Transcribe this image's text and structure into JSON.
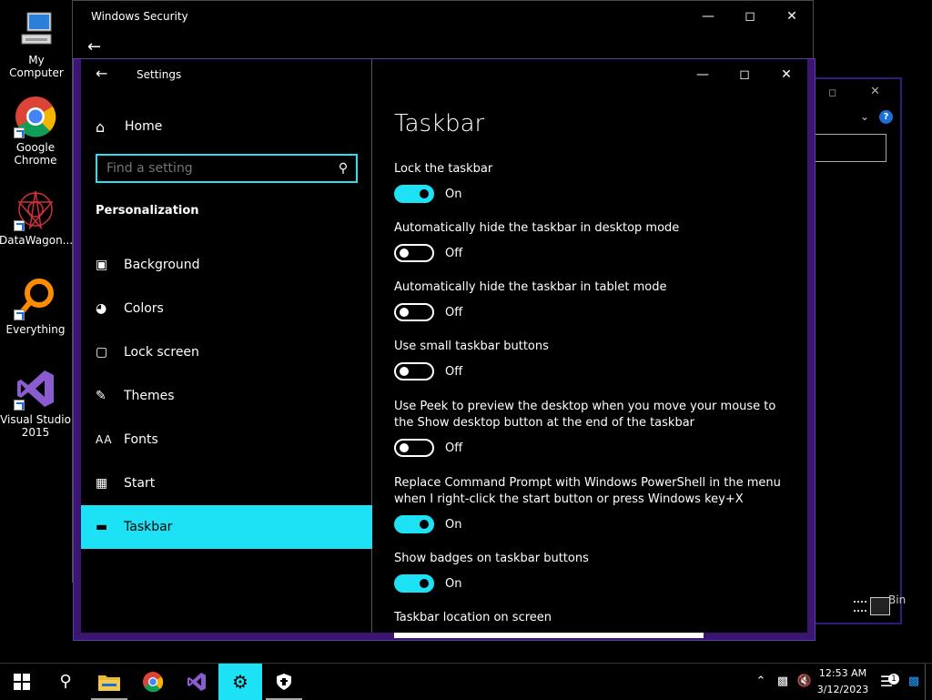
{
  "desktop": {
    "icons": [
      {
        "label": "My Computer",
        "icon": "computer-icon"
      },
      {
        "label": "Google Chrome",
        "icon": "chrome-icon"
      },
      {
        "label": "DataWagon...",
        "icon": "datawagon-icon"
      },
      {
        "label": "Everything",
        "icon": "everything-icon"
      },
      {
        "label": "Visual Studio 2015",
        "icon": "visual-studio-icon"
      }
    ]
  },
  "windows_security": {
    "title": "Windows Security"
  },
  "third_window": {
    "partial_text": "Bin"
  },
  "settings": {
    "window_title": "Settings",
    "home_label": "Home",
    "search_placeholder": "Find a setting",
    "section_title": "Personalization",
    "nav": [
      {
        "label": "Background",
        "icon": "picture-icon"
      },
      {
        "label": "Colors",
        "icon": "palette-icon"
      },
      {
        "label": "Lock screen",
        "icon": "lock-screen-icon"
      },
      {
        "label": "Themes",
        "icon": "brush-icon"
      },
      {
        "label": "Fonts",
        "icon": "fonts-icon"
      },
      {
        "label": "Start",
        "icon": "start-icon"
      },
      {
        "label": "Taskbar",
        "icon": "taskbar-icon",
        "active": true
      }
    ],
    "page_title": "Taskbar",
    "settings": [
      {
        "label": "Lock the taskbar",
        "state": "On"
      },
      {
        "label": "Automatically hide the taskbar in desktop mode",
        "state": "Off"
      },
      {
        "label": "Automatically hide the taskbar in tablet mode",
        "state": "Off"
      },
      {
        "label": "Use small taskbar buttons",
        "state": "Off"
      },
      {
        "label": "Use Peek to preview the desktop when you move your mouse to the Show desktop button at the end of the taskbar",
        "state": "Off"
      },
      {
        "label": "Replace Command Prompt with Windows PowerShell in the menu when I right-click the start button or press Windows key+X",
        "state": "On"
      },
      {
        "label": "Show badges on taskbar buttons",
        "state": "On"
      }
    ],
    "location_label": "Taskbar location on screen"
  },
  "taskbar": {
    "apps": [
      "start-icon",
      "search-icon",
      "file-explorer-icon",
      "chrome-icon",
      "visual-studio-icon",
      "settings-gear-icon",
      "windows-security-icon"
    ],
    "clock_time": "12:53 AM",
    "clock_date": "3/12/2023",
    "notification_count": "1"
  },
  "colors": {
    "accent": "#1de2f5",
    "window_border": "#3a1670"
  }
}
